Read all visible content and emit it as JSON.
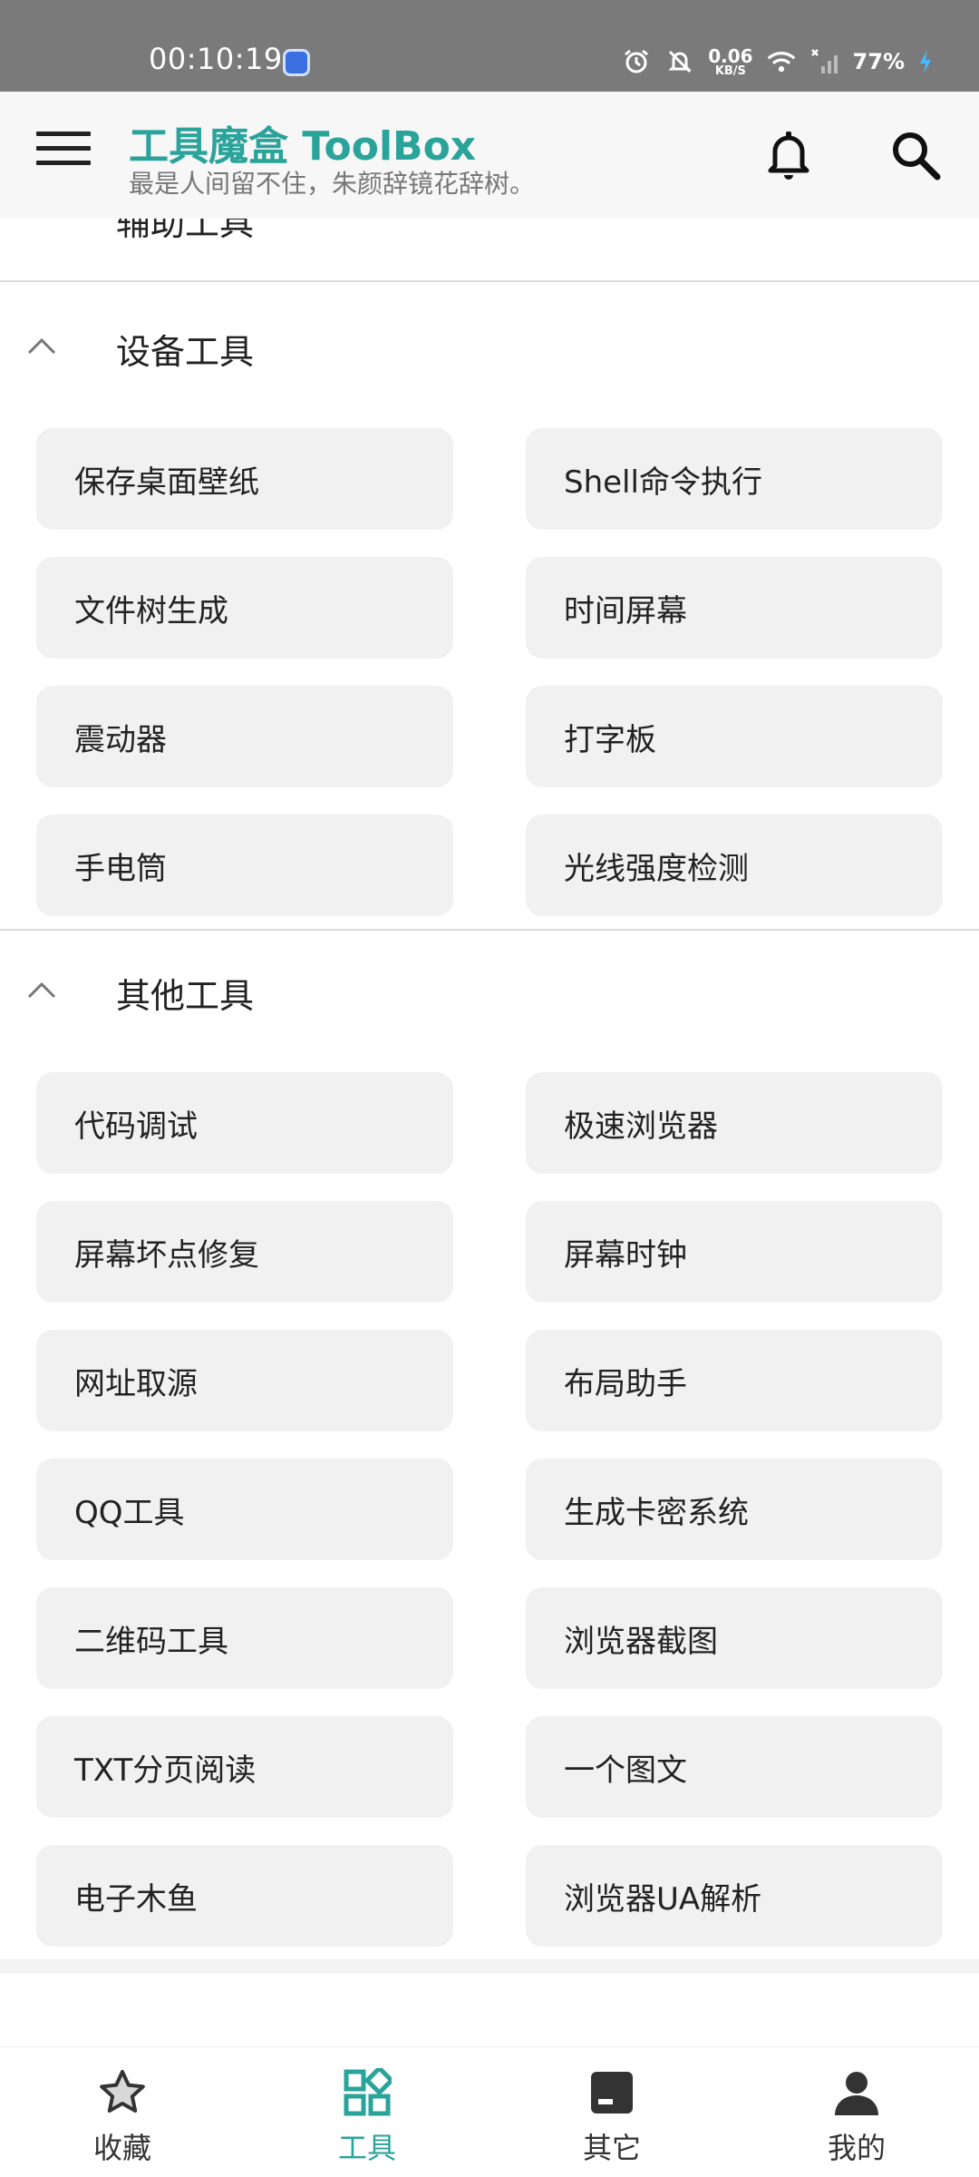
{
  "status_bar": {
    "time": "00:10:19",
    "net_speed_value": "0.06",
    "net_speed_unit": "KB/S",
    "battery": "77%"
  },
  "app_bar": {
    "title": "工具魔盒 ToolBox",
    "subtitle": "最是人间留不住，朱颜辞镜花辞树。"
  },
  "sections": {
    "partial": {
      "title": "辅助工具"
    },
    "device": {
      "title": "设备工具",
      "items": [
        "保存桌面壁纸",
        "Shell命令执行",
        "文件树生成",
        "时间屏幕",
        "震动器",
        "打字板",
        "手电筒",
        "光线强度检测"
      ]
    },
    "other": {
      "title": "其他工具",
      "items": [
        "代码调试",
        "极速浏览器",
        "屏幕坏点修复",
        "屏幕时钟",
        "网址取源",
        "布局助手",
        "QQ工具",
        "生成卡密系统",
        "二维码工具",
        "浏览器截图",
        "TXT分页阅读",
        "一个图文",
        "电子木鱼",
        "浏览器UA解析"
      ]
    }
  },
  "bottom_nav": {
    "items": [
      {
        "label": "收藏",
        "icon": "star-icon"
      },
      {
        "label": "工具",
        "icon": "grid-icon"
      },
      {
        "label": "其它",
        "icon": "card-icon"
      },
      {
        "label": "我的",
        "icon": "person-icon"
      }
    ],
    "active_index": 1
  },
  "colors": {
    "accent": "#2aa39a",
    "button_bg": "#f1f1f1",
    "status_bar": "#7a7a7a"
  }
}
